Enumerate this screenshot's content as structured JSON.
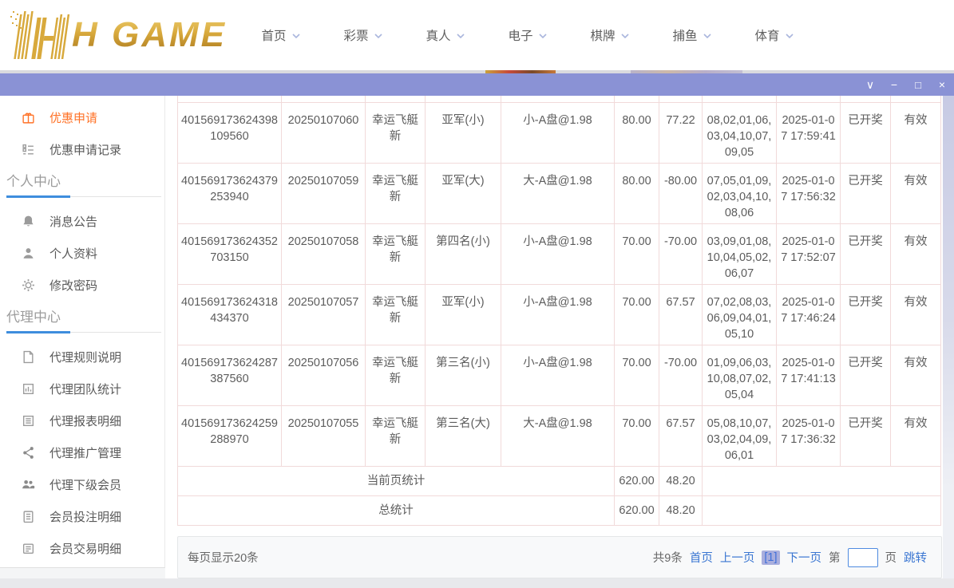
{
  "header": {
    "logo_text": "H GAME",
    "nav": [
      {
        "label": "首页"
      },
      {
        "label": "彩票"
      },
      {
        "label": "真人"
      },
      {
        "label": "电子"
      },
      {
        "label": "棋牌"
      },
      {
        "label": "捕鱼"
      },
      {
        "label": "体育"
      }
    ]
  },
  "titlebar": {
    "controls": [
      "chevron-down",
      "minimize",
      "maximize",
      "close"
    ]
  },
  "sidebar": {
    "top_items": [
      {
        "label": "优惠申请",
        "icon": "coupon-icon",
        "active": true
      },
      {
        "label": "优惠申请记录",
        "icon": "records-icon",
        "active": false
      }
    ],
    "sections": [
      {
        "title": "个人中心",
        "items": [
          {
            "label": "消息公告",
            "icon": "bell-icon"
          },
          {
            "label": "个人资料",
            "icon": "user-icon"
          },
          {
            "label": "修改密码",
            "icon": "gear-icon"
          }
        ]
      },
      {
        "title": "代理中心",
        "items": [
          {
            "label": "代理规则说明",
            "icon": "doc-icon"
          },
          {
            "label": "代理团队统计",
            "icon": "chart-icon"
          },
          {
            "label": "代理报表明细",
            "icon": "report-icon"
          },
          {
            "label": "代理推广管理",
            "icon": "share-icon"
          },
          {
            "label": "代理下级会员",
            "icon": "users-icon"
          },
          {
            "label": "会员投注明细",
            "icon": "bet-list-icon"
          },
          {
            "label": "会员交易明细",
            "icon": "transaction-icon"
          }
        ]
      }
    ]
  },
  "table": {
    "rows": [
      {
        "order_id": "401569173624398109560",
        "period": "20250107060",
        "game": "幸运飞艇新",
        "play": "亚军(小)",
        "content": "小-A盘@1.98",
        "amount": "80.00",
        "profit": "77.22",
        "numbers": "08,02,01,06,03,04,10,07,09,05",
        "time": "2025-01-07 17:59:41",
        "status": "已开奖",
        "valid": "有效"
      },
      {
        "order_id": "401569173624379253940",
        "period": "20250107059",
        "game": "幸运飞艇新",
        "play": "亚军(大)",
        "content": "大-A盘@1.98",
        "amount": "80.00",
        "profit": "-80.00",
        "numbers": "07,05,01,09,02,03,04,10,08,06",
        "time": "2025-01-07 17:56:32",
        "status": "已开奖",
        "valid": "有效"
      },
      {
        "order_id": "401569173624352703150",
        "period": "20250107058",
        "game": "幸运飞艇新",
        "play": "第四名(小)",
        "content": "小-A盘@1.98",
        "amount": "70.00",
        "profit": "-70.00",
        "numbers": "03,09,01,08,10,04,05,02,06,07",
        "time": "2025-01-07 17:52:07",
        "status": "已开奖",
        "valid": "有效"
      },
      {
        "order_id": "401569173624318434370",
        "period": "20250107057",
        "game": "幸运飞艇新",
        "play": "亚军(小)",
        "content": "小-A盘@1.98",
        "amount": "70.00",
        "profit": "67.57",
        "numbers": "07,02,08,03,06,09,04,01,05,10",
        "time": "2025-01-07 17:46:24",
        "status": "已开奖",
        "valid": "有效"
      },
      {
        "order_id": "401569173624287387560",
        "period": "20250107056",
        "game": "幸运飞艇新",
        "play": "第三名(小)",
        "content": "小-A盘@1.98",
        "amount": "70.00",
        "profit": "-70.00",
        "numbers": "01,09,06,03,10,08,07,02,05,04",
        "time": "2025-01-07 17:41:13",
        "status": "已开奖",
        "valid": "有效"
      },
      {
        "order_id": "401569173624259288970",
        "period": "20250107055",
        "game": "幸运飞艇新",
        "play": "第三名(大)",
        "content": "大-A盘@1.98",
        "amount": "70.00",
        "profit": "67.57",
        "numbers": "05,08,10,07,03,02,04,09,06,01",
        "time": "2025-01-07 17:36:32",
        "status": "已开奖",
        "valid": "有效"
      }
    ],
    "summary": [
      {
        "label": "当前页统计",
        "amount": "620.00",
        "profit": "48.20"
      },
      {
        "label": "总统计",
        "amount": "620.00",
        "profit": "48.20"
      }
    ]
  },
  "pagination": {
    "page_size_text": "每页显示20条",
    "total_text": "共9条",
    "first_label": "首页",
    "prev_label": "上一页",
    "current_page": "[1]",
    "next_label": "下一页",
    "jump_prefix": "第",
    "jump_suffix": "页",
    "jump_action": "跳转",
    "jump_value": ""
  },
  "colors": {
    "titlebar_purple": "#8a92d5",
    "active_orange": "#ff7227",
    "link_blue": "#3a76d2",
    "table_border_pink": "#f1dada",
    "logo_gold": "#d8a93c"
  }
}
